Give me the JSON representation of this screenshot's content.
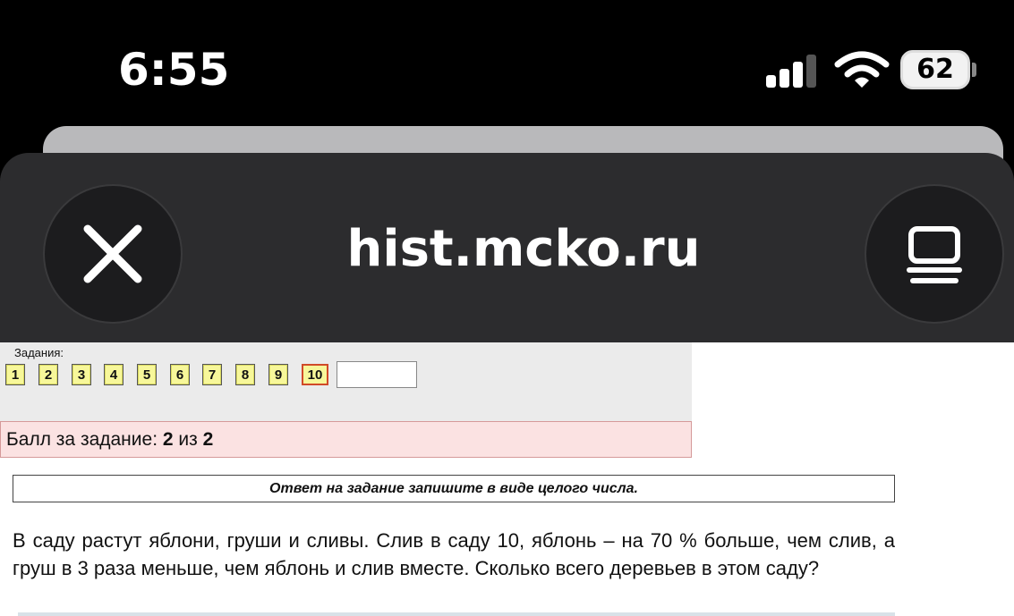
{
  "status_bar": {
    "time": "6:55",
    "battery_level": "62"
  },
  "browser": {
    "domain": "hist.mcko.ru",
    "close_icon": "close-icon",
    "reader_icon": "reader-view-icon"
  },
  "tasks": {
    "label": "Задания:",
    "items": [
      "1",
      "2",
      "3",
      "4",
      "5",
      "6",
      "7",
      "8",
      "9",
      "10"
    ],
    "active_index": 9,
    "answer_value": ""
  },
  "score": {
    "prefix": "Балл за задание: ",
    "value": "2",
    "separator": " из ",
    "max": "2"
  },
  "instruction": "Ответ на задание запишите в виде целого числа.",
  "problem": "В саду растут яблони, груши и сливы. Слив в саду 10, яблонь – на 70 % больше, чем слив, а груш в 3 раза меньше, чем яблонь и слив вместе. Сколько всего деревьев в этом саду?",
  "colors": {
    "task_button": "#f7f79a",
    "active_border": "#d04a28",
    "score_background": "#fbe2e2"
  }
}
